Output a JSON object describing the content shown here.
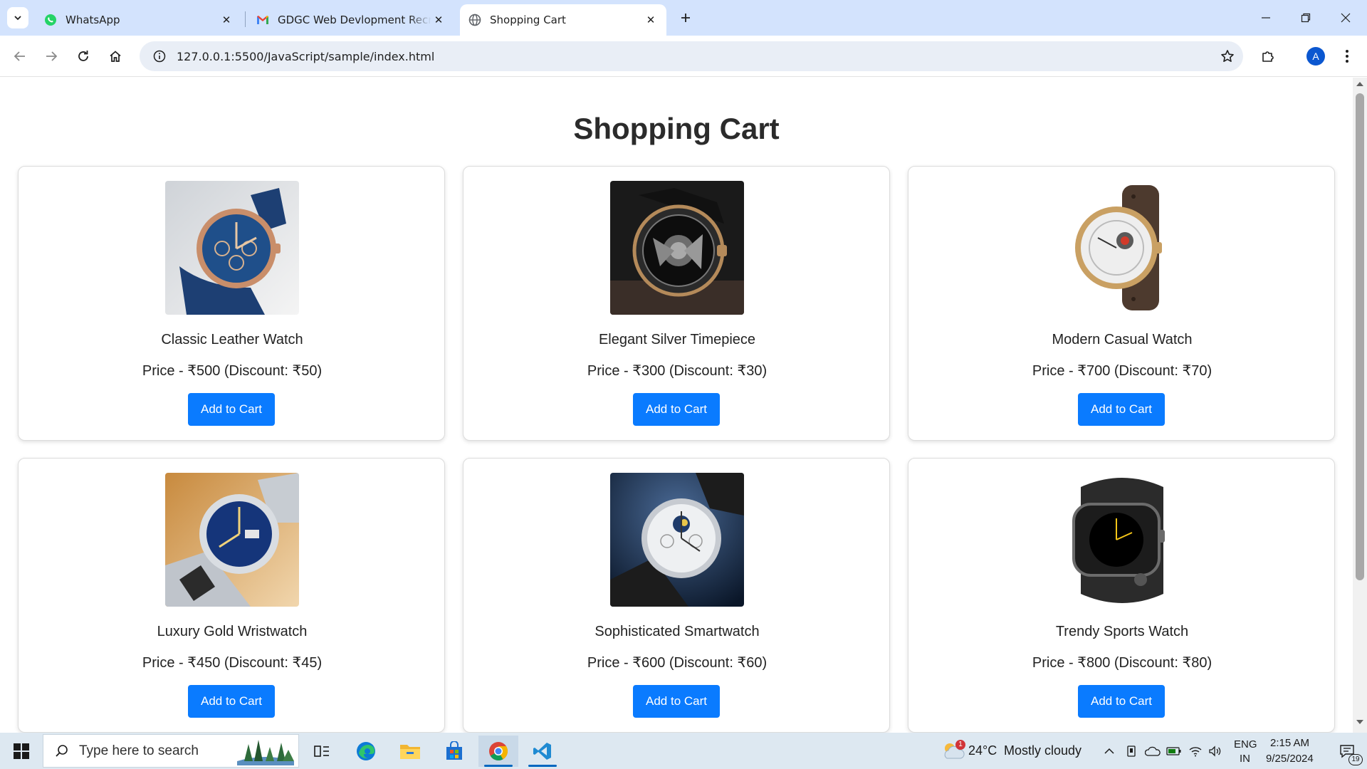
{
  "browser": {
    "tabs": [
      {
        "title": "WhatsApp",
        "icon": "whatsapp-icon",
        "active": false
      },
      {
        "title": "GDGC Web Devlopment Recruitment",
        "icon": "gmail-icon",
        "active": false
      },
      {
        "title": "Shopping Cart",
        "icon": "globe-icon",
        "active": true
      }
    ],
    "url": "127.0.0.1:5500/JavaScript/sample/index.html",
    "profile_initial": "A",
    "colors": {
      "tabstrip": "#d3e3fd",
      "omnibox": "#e9eef6",
      "avatar": "#0b57d0"
    }
  },
  "page": {
    "title": "Shopping Cart",
    "button_color": "#0a7bff",
    "products": [
      {
        "name": "Classic Leather Watch",
        "price": "Price - ₹500 (Discount: ₹50)",
        "button": "Add to Cart"
      },
      {
        "name": "Elegant Silver Timepiece",
        "price": "Price - ₹300 (Discount: ₹30)",
        "button": "Add to Cart"
      },
      {
        "name": "Modern Casual Watch",
        "price": "Price - ₹700 (Discount: ₹70)",
        "button": "Add to Cart"
      },
      {
        "name": "Luxury Gold Wristwatch",
        "price": "Price - ₹450 (Discount: ₹45)",
        "button": "Add to Cart"
      },
      {
        "name": "Sophisticated Smartwatch",
        "price": "Price - ₹600 (Discount: ₹60)",
        "button": "Add to Cart"
      },
      {
        "name": "Trendy Sports Watch",
        "price": "Price - ₹800 (Discount: ₹80)",
        "button": "Add to Cart"
      }
    ]
  },
  "taskbar": {
    "search_placeholder": "Type here to search",
    "weather": {
      "temp": "24°C",
      "condition": "Mostly cloudy",
      "alert_count": "1"
    },
    "language": {
      "lang": "ENG",
      "region": "IN"
    },
    "time": "2:15 AM",
    "date": "9/25/2024",
    "notification_count": "19"
  }
}
